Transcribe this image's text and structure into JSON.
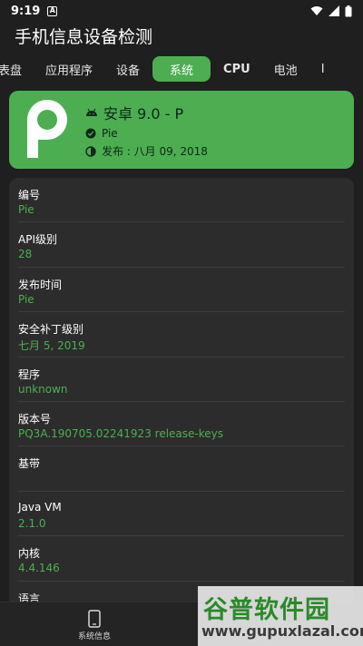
{
  "status_bar": {
    "time": "9:19",
    "notif_badge": "A"
  },
  "app": {
    "title": "手机信息设备检测"
  },
  "tabs": [
    {
      "label": "表盘"
    },
    {
      "label": "应用程序"
    },
    {
      "label": "设备"
    },
    {
      "label": "系统",
      "active": true
    },
    {
      "label": "CPU"
    },
    {
      "label": "电池"
    },
    {
      "label": "I"
    }
  ],
  "hero": {
    "title": "安卓 9.0 - P",
    "codename": "Pie",
    "release": "发布 : 八月 09, 2018",
    "accent": "#4cae50"
  },
  "rows": [
    {
      "label": "编号",
      "value": "Pie"
    },
    {
      "label": "API级别",
      "value": "28"
    },
    {
      "label": "发布时间",
      "value": "Pie"
    },
    {
      "label": "安全补丁级别",
      "value": "七月 5, 2019"
    },
    {
      "label": "程序",
      "value": "unknown"
    },
    {
      "label": "版本号",
      "value": "PQ3A.190705.02241923 release-keys"
    },
    {
      "label": "基带",
      "value": ""
    },
    {
      "label": "Java VM",
      "value": "2.1.0"
    },
    {
      "label": "内核",
      "value": "4.4.146"
    },
    {
      "label": "语言",
      "value": ""
    }
  ],
  "bottom_nav": {
    "label": "系统信息"
  },
  "watermark": {
    "brand": "谷普软件园",
    "url": "www.gupuxlazal.com"
  }
}
